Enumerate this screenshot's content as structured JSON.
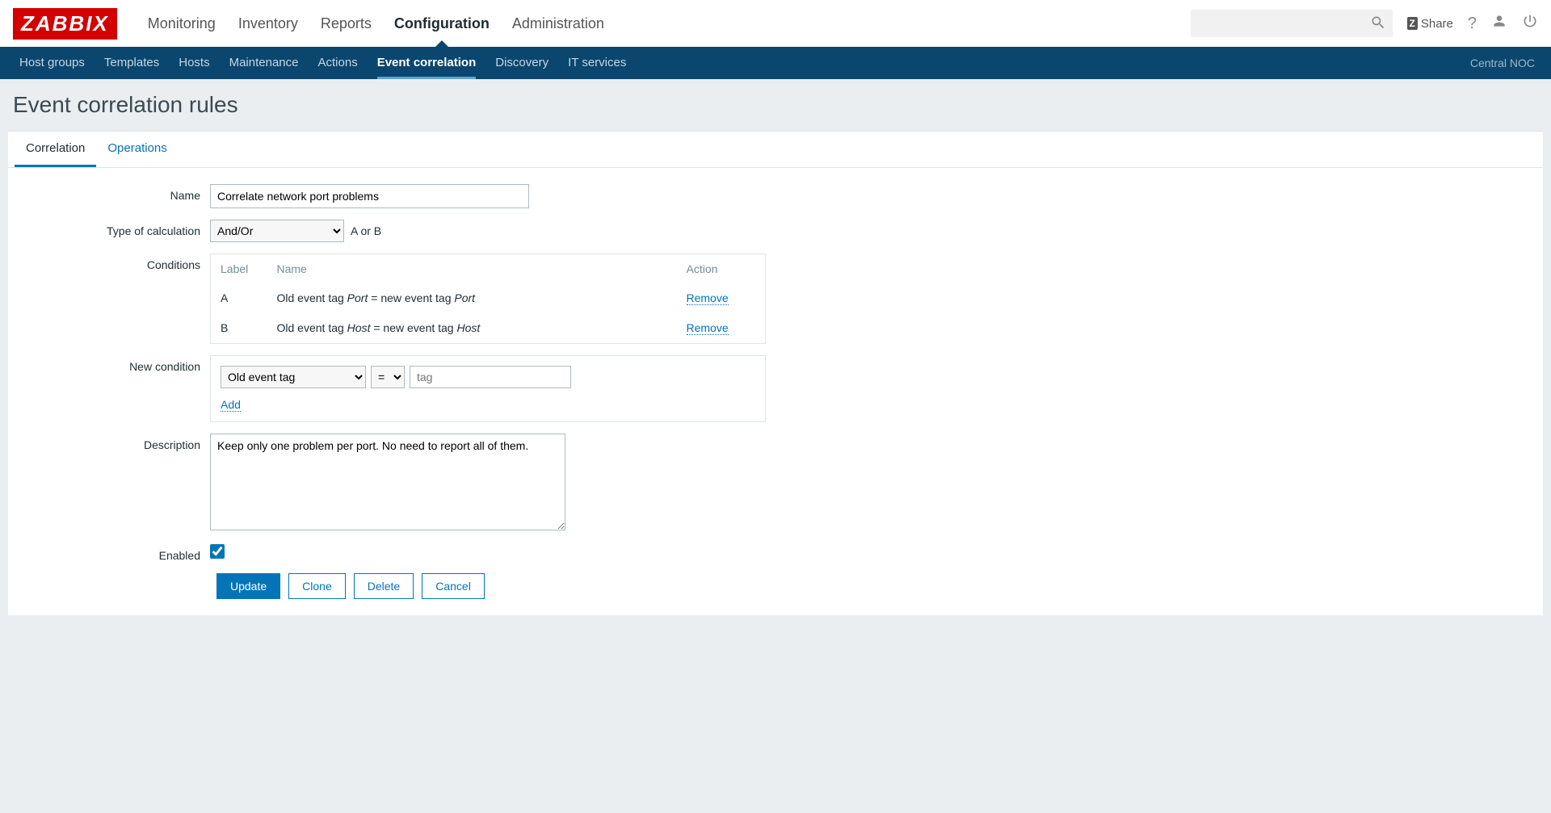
{
  "brand": "ZABBIX",
  "topnav": {
    "items": [
      "Monitoring",
      "Inventory",
      "Reports",
      "Configuration",
      "Administration"
    ],
    "active": "Configuration"
  },
  "share_label": "Share",
  "subnav": {
    "items": [
      "Host groups",
      "Templates",
      "Hosts",
      "Maintenance",
      "Actions",
      "Event correlation",
      "Discovery",
      "IT services"
    ],
    "active": "Event correlation",
    "location": "Central NOC"
  },
  "page_title": "Event correlation rules",
  "tabs": {
    "items": [
      "Correlation",
      "Operations"
    ],
    "active": "Correlation"
  },
  "form": {
    "name_label": "Name",
    "name_value": "Correlate network port problems",
    "calc_label": "Type of calculation",
    "calc_value": "And/Or",
    "calc_expr": "A or B",
    "cond_label": "Conditions",
    "cond_headers": {
      "label": "Label",
      "name": "Name",
      "action": "Action"
    },
    "conditions": [
      {
        "label": "A",
        "prefix": "Old event tag ",
        "tag1": "Port",
        "mid": " = new event tag ",
        "tag2": "Port"
      },
      {
        "label": "B",
        "prefix": "Old event tag ",
        "tag1": "Host",
        "mid": " = new event tag ",
        "tag2": "Host"
      }
    ],
    "remove_label": "Remove",
    "newcond_label": "New condition",
    "newcond_type": "Old event tag",
    "newcond_op": "=",
    "newcond_tag_placeholder": "tag",
    "add_label": "Add",
    "desc_label": "Description",
    "desc_value": "Keep only one problem per port. No need to report all of them.",
    "enabled_label": "Enabled",
    "enabled": true,
    "buttons": {
      "update": "Update",
      "clone": "Clone",
      "delete": "Delete",
      "cancel": "Cancel"
    }
  }
}
